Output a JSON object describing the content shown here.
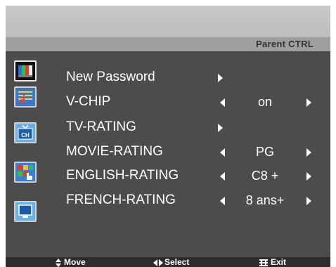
{
  "header": {
    "title": "Parent CTRL"
  },
  "sidebar": {
    "icons": [
      {
        "name": "picture-icon",
        "active": true
      },
      {
        "name": "sound-icon",
        "active": false
      },
      {
        "name": "channel-icon",
        "active": false
      },
      {
        "name": "function-icon",
        "active": false
      },
      {
        "name": "screen-icon",
        "active": false
      }
    ]
  },
  "menu": {
    "items": [
      {
        "label": "New Password",
        "value": ""
      },
      {
        "label": "V-CHIP",
        "value": "on"
      },
      {
        "label": "TV-RATING",
        "value": ""
      },
      {
        "label": "MOVIE-RATING",
        "value": "PG"
      },
      {
        "label": "ENGLISH-RATING",
        "value": "C8 +"
      },
      {
        "label": "FRENCH-RATING",
        "value": "8 ans+"
      }
    ]
  },
  "footer": {
    "move_label": "Move",
    "select_label": "Select",
    "exit_label": "Exit"
  }
}
